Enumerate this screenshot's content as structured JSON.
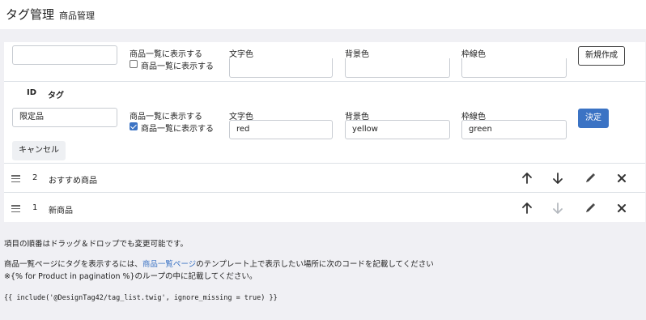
{
  "header": {
    "title": "タグ管理",
    "subtitle": "商品管理"
  },
  "new_row": {
    "name_value": "",
    "show_label": "商品一覧に表示する",
    "checkbox_label": "商品一覧に表示する",
    "text_color_label": "文字色",
    "bg_color_label": "背景色",
    "border_color_label": "枠線色",
    "create_button": "新規作成"
  },
  "table": {
    "col_id": "ID",
    "col_tag": "タグ"
  },
  "edit_row": {
    "name_value": "限定品",
    "show_label": "商品一覧に表示する",
    "checkbox_label": "商品一覧に表示する",
    "checked": true,
    "text_color_label": "文字色",
    "text_color_value": "red",
    "bg_color_label": "背景色",
    "bg_color_value": "yellow",
    "border_color_label": "枠線色",
    "border_color_value": "green",
    "decide_button": "決定",
    "cancel_button": "キャンセル"
  },
  "items": [
    {
      "id": "2",
      "name": "おすすめ商品"
    },
    {
      "id": "1",
      "name": "新商品"
    }
  ],
  "footer": {
    "note": "項目の順番はドラッグ＆ドロップでも変更可能です。",
    "line1_pre": "商品一覧ページにタグを表示するには、",
    "line1_link": "商品一覧ページ",
    "line1_post": "のテンプレート上で表示したい場所に次のコードを記載してください",
    "line2": "※{% for Product in pagination %}のループの中に記載してください。",
    "code": "{{ include('@DesignTag42/tag_list.twig', ignore_missing = true) }}"
  },
  "colors": {
    "primary": "#3b73c4",
    "background": "#f0f0f4"
  }
}
